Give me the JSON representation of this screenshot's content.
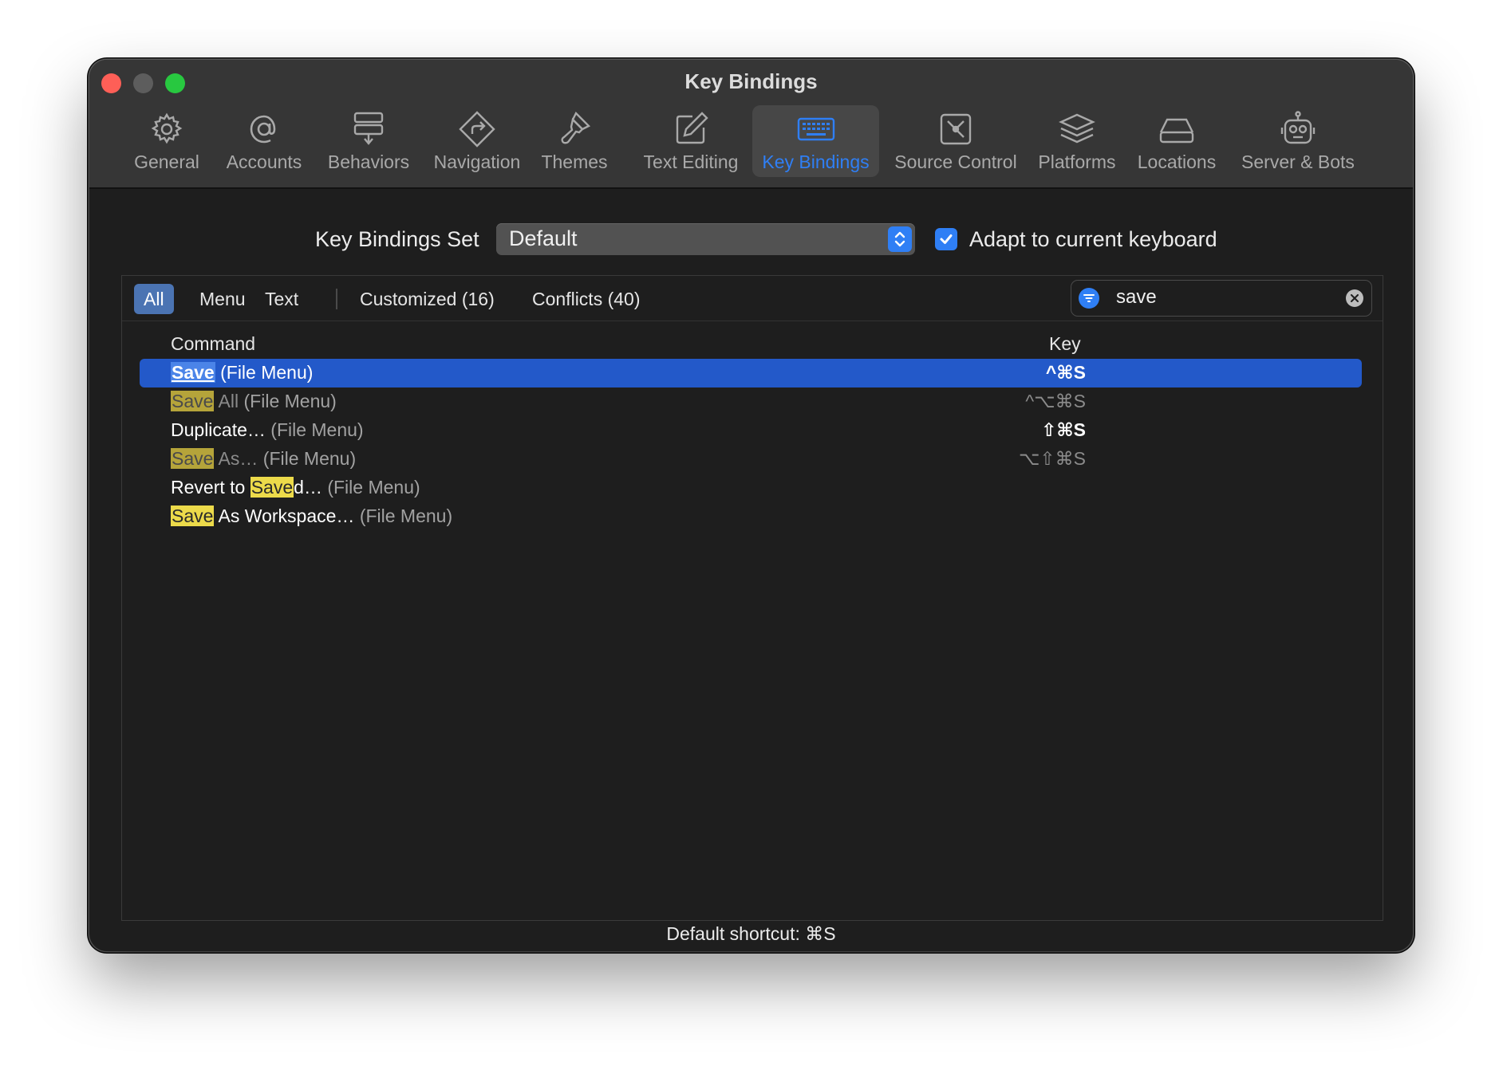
{
  "window": {
    "title": "Key Bindings"
  },
  "toolbar": {
    "items": [
      {
        "label": "General",
        "icon": "gear-icon",
        "active": false
      },
      {
        "label": "Accounts",
        "icon": "at-sign-icon",
        "active": false
      },
      {
        "label": "Behaviors",
        "icon": "behaviors-icon",
        "active": false
      },
      {
        "label": "Navigation",
        "icon": "navigation-icon",
        "active": false
      },
      {
        "label": "Themes",
        "icon": "paintbrush-icon",
        "active": false
      },
      {
        "label": "Text Editing",
        "icon": "edit-icon",
        "active": false
      },
      {
        "label": "Key Bindings",
        "icon": "keyboard-icon",
        "active": true
      },
      {
        "label": "Source Control",
        "icon": "source-control-icon",
        "active": false
      },
      {
        "label": "Platforms",
        "icon": "stack-icon",
        "active": false
      },
      {
        "label": "Locations",
        "icon": "drive-icon",
        "active": false
      },
      {
        "label": "Server & Bots",
        "icon": "robot-icon",
        "active": false
      }
    ]
  },
  "settings": {
    "set_label": "Key Bindings Set",
    "set_value": "Default",
    "adapt_label": "Adapt to current keyboard",
    "adapt_checked": true
  },
  "filters": {
    "tabs": [
      "All",
      "Menu",
      "Text",
      "Customized (16)",
      "Conflicts (40)"
    ],
    "active": "All",
    "search_value": "save",
    "search_placeholder": "Filter"
  },
  "table": {
    "headers": {
      "command": "Command",
      "key": "Key"
    },
    "rows": [
      {
        "match": "Save",
        "rest": "",
        "menu": "(File Menu)",
        "key": "^⌘S",
        "selected": true,
        "dim": false
      },
      {
        "match": "Save",
        "rest": " All",
        "menu": "(File Menu)",
        "key": "^⌥⌘S",
        "selected": false,
        "dim": true
      },
      {
        "pre": "Duplicate… ",
        "match": "",
        "rest": "",
        "menu": "(File Menu)",
        "key": "⇧⌘S",
        "selected": false,
        "dim": false
      },
      {
        "match": "Save",
        "rest": " As…",
        "menu": "(File Menu)",
        "key": "⌥⇧⌘S",
        "selected": false,
        "dim": true
      },
      {
        "pre": "Revert to ",
        "match": "Save",
        "rest": "d…",
        "menu": "(File Menu)",
        "key": "",
        "selected": false,
        "dim": false
      },
      {
        "match": "Save",
        "rest": " As Workspace…",
        "menu": "(File Menu)",
        "key": "",
        "selected": false,
        "dim": false
      }
    ]
  },
  "status": {
    "text": "Default shortcut: ⌘S"
  },
  "colors": {
    "accent": "#2f7ff5",
    "selection": "#2359c9",
    "highlight": "#ecda4a",
    "background": "#1e1e1e"
  }
}
